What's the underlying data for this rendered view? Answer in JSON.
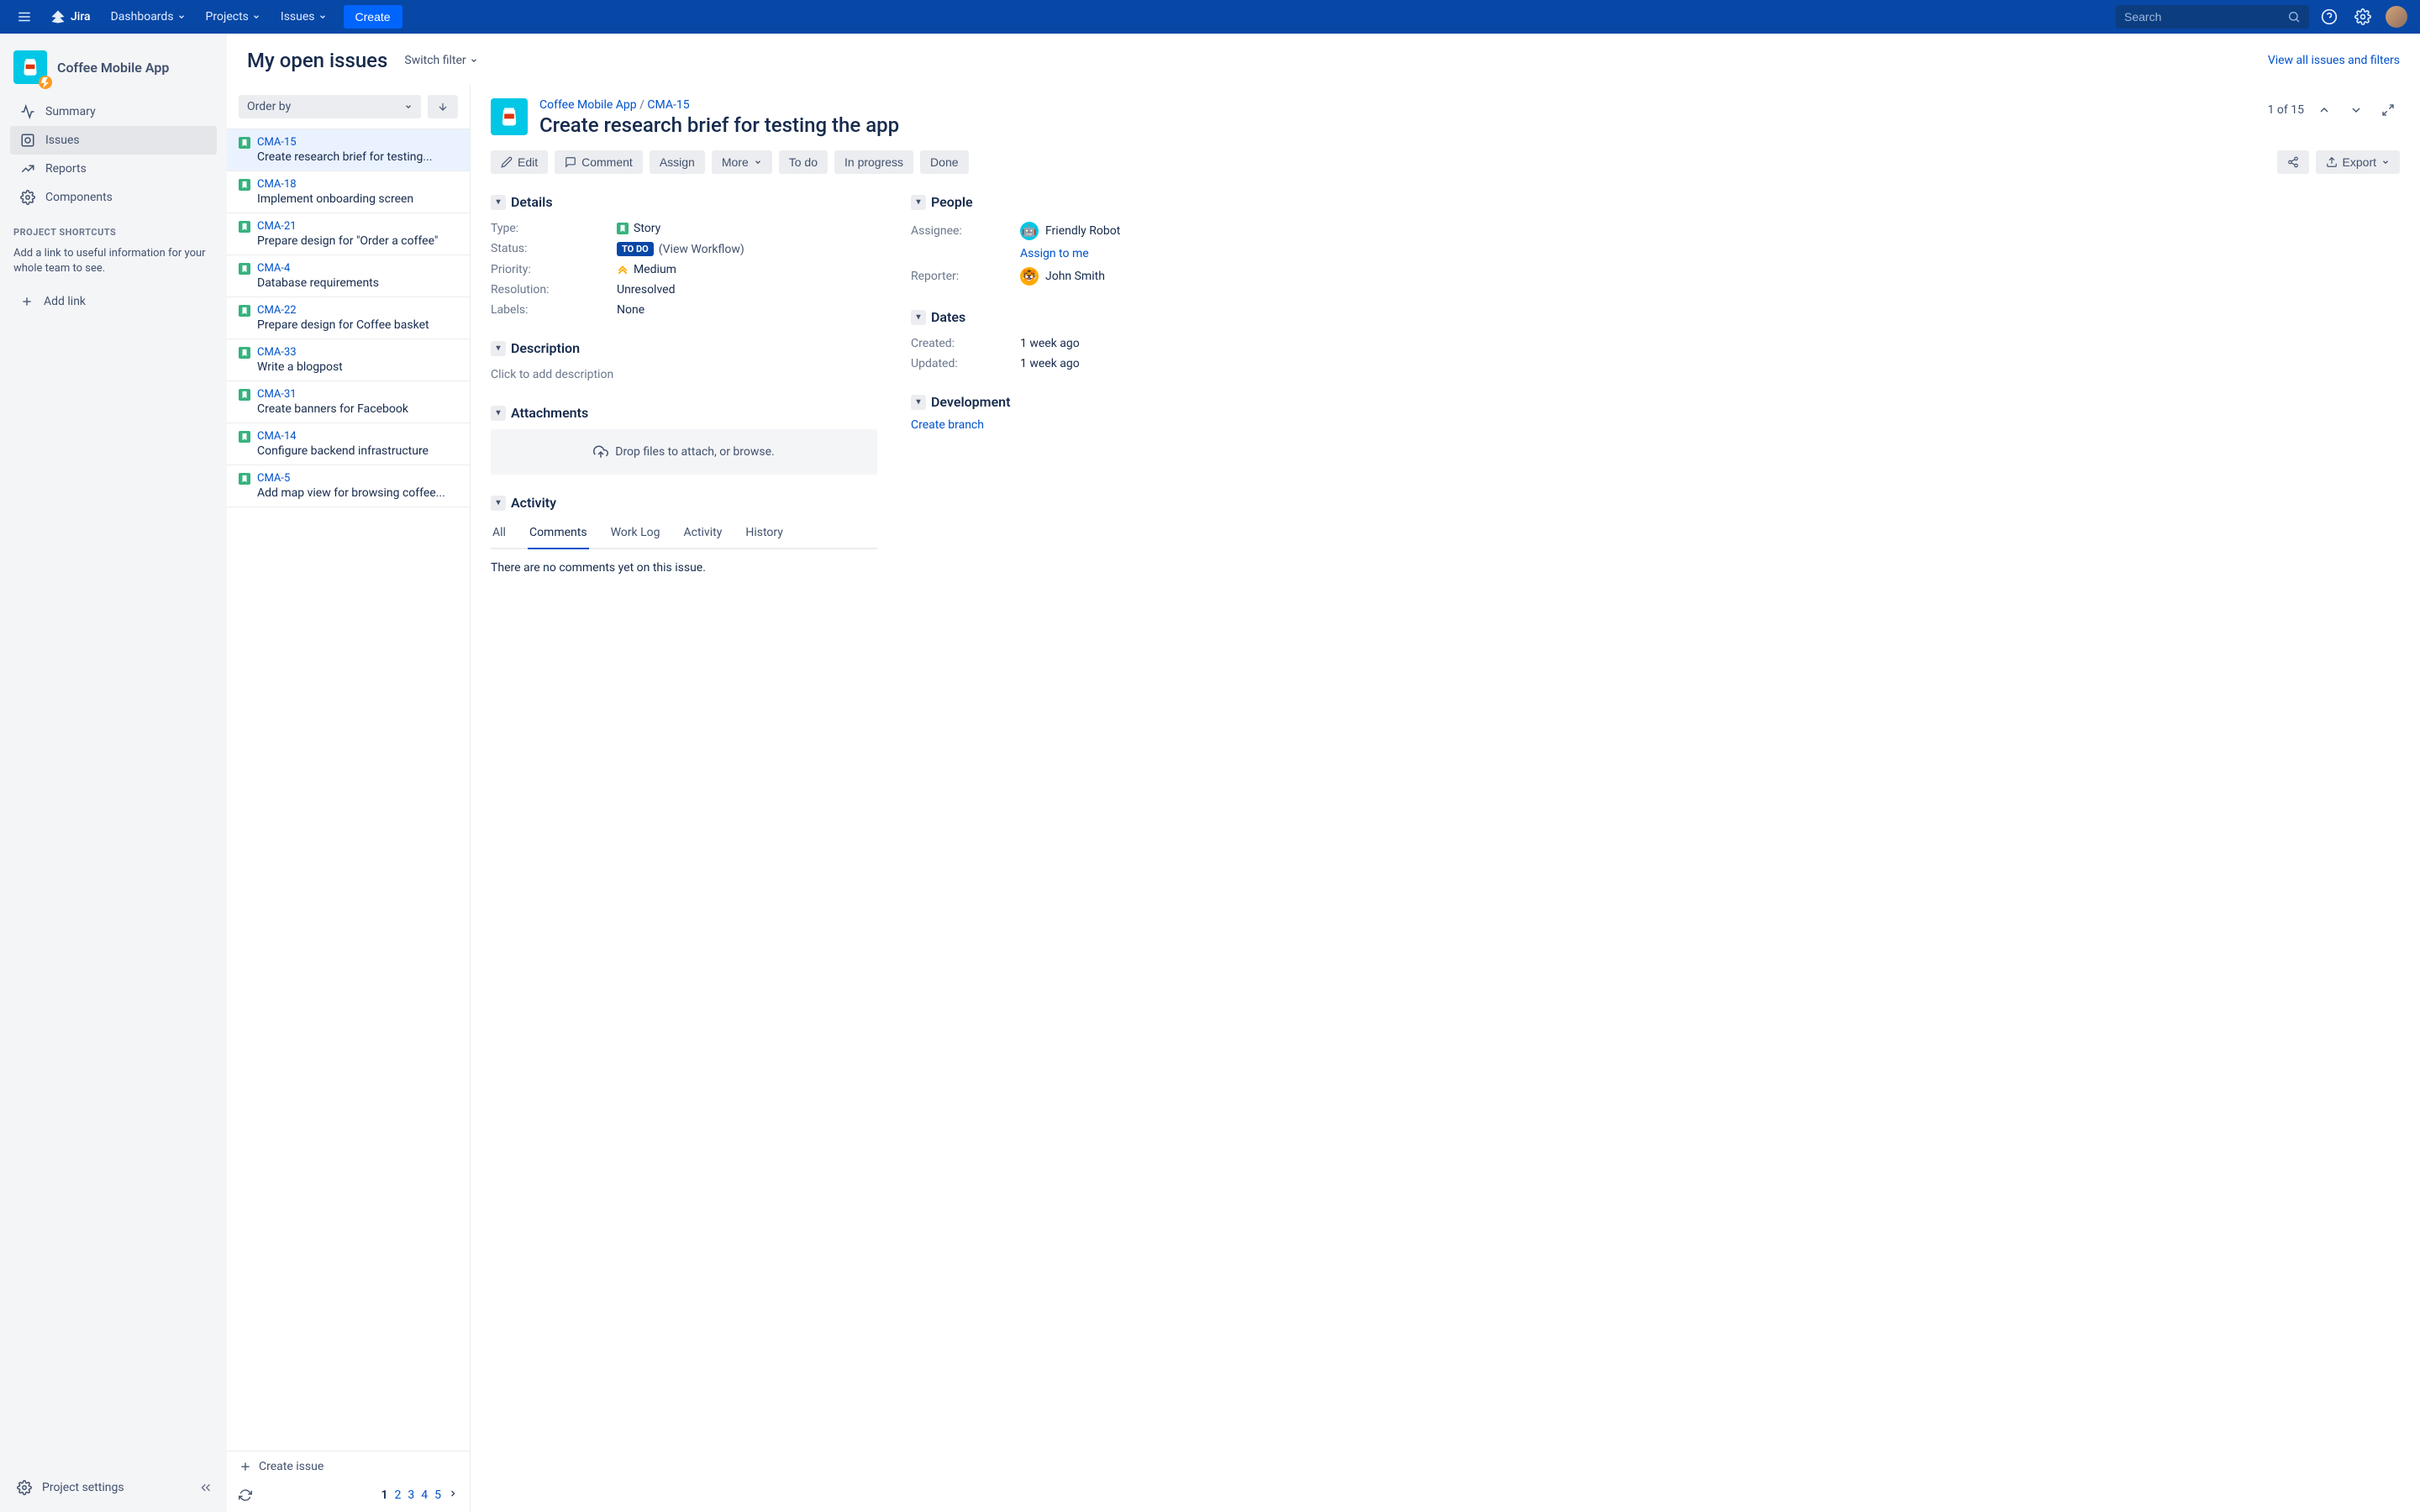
{
  "topnav": {
    "product": "Jira",
    "items": [
      "Dashboards",
      "Projects",
      "Issues"
    ],
    "create": "Create",
    "search_placeholder": "Search"
  },
  "sidebar": {
    "project_name": "Coffee Mobile App",
    "items": [
      {
        "label": "Summary",
        "icon": "activity"
      },
      {
        "label": "Issues",
        "icon": "issues",
        "active": true
      },
      {
        "label": "Reports",
        "icon": "reports"
      },
      {
        "label": "Components",
        "icon": "components"
      }
    ],
    "shortcuts_title": "PROJECT SHORTCUTS",
    "shortcuts_help": "Add a link to useful information for your whole team to see.",
    "add_link": "Add link",
    "settings": "Project settings"
  },
  "header": {
    "title": "My open issues",
    "switch_filter": "Switch filter",
    "view_all": "View all issues and filters"
  },
  "list": {
    "order_by": "Order by",
    "create_issue": "Create issue",
    "issues": [
      {
        "key": "CMA-15",
        "summary": "Create research brief for testing...",
        "selected": true
      },
      {
        "key": "CMA-18",
        "summary": "Implement onboarding screen"
      },
      {
        "key": "CMA-21",
        "summary": "Prepare design for \"Order a coffee\""
      },
      {
        "key": "CMA-4",
        "summary": "Database requirements"
      },
      {
        "key": "CMA-22",
        "summary": "Prepare design for Coffee basket"
      },
      {
        "key": "CMA-33",
        "summary": "Write a blogpost"
      },
      {
        "key": "CMA-31",
        "summary": "Create banners for Facebook"
      },
      {
        "key": "CMA-14",
        "summary": "Configure backend infrastructure"
      },
      {
        "key": "CMA-5",
        "summary": "Add map view for browsing coffee..."
      }
    ],
    "pages": [
      "1",
      "2",
      "3",
      "4",
      "5"
    ]
  },
  "detail": {
    "breadcrumb_project": "Coffee Mobile App",
    "breadcrumb_key": "CMA-15",
    "title": "Create research brief for testing the app",
    "position": "1 of 15",
    "actions": {
      "edit": "Edit",
      "comment": "Comment",
      "assign": "Assign",
      "more": "More",
      "todo": "To do",
      "inprogress": "In progress",
      "done": "Done",
      "export": "Export"
    },
    "sections": {
      "details": "Details",
      "description": "Description",
      "attachments": "Attachments",
      "activity": "Activity",
      "people": "People",
      "dates": "Dates",
      "development": "Development"
    },
    "fields": {
      "type_label": "Type:",
      "type_value": "Story",
      "status_label": "Status:",
      "status_value": "TO DO",
      "view_workflow": "(View Workflow)",
      "priority_label": "Priority:",
      "priority_value": "Medium",
      "resolution_label": "Resolution:",
      "resolution_value": "Unresolved",
      "labels_label": "Labels:",
      "labels_value": "None"
    },
    "desc_placeholder": "Click to add description",
    "attach_placeholder": "Drop files to attach, or browse.",
    "tabs": [
      "All",
      "Comments",
      "Work Log",
      "Activity",
      "History"
    ],
    "active_tab": 1,
    "no_comments": "There are no comments yet on this issue.",
    "people": {
      "assignee_label": "Assignee:",
      "assignee_value": "Friendly Robot",
      "assign_to_me": "Assign to me",
      "reporter_label": "Reporter:",
      "reporter_value": "John Smith"
    },
    "dates": {
      "created_label": "Created:",
      "created_value": "1 week ago",
      "updated_label": "Updated:",
      "updated_value": "1 week ago"
    },
    "dev": {
      "create_branch": "Create branch"
    }
  }
}
